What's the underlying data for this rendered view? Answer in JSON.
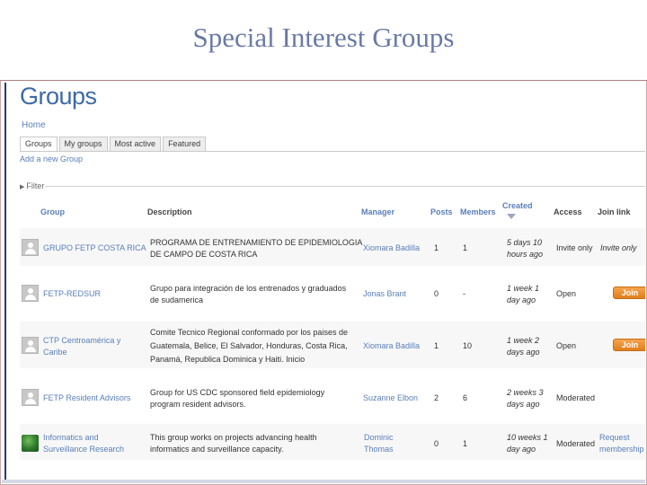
{
  "slide": {
    "title": "Special Interest Groups"
  },
  "page": {
    "heading": "Groups",
    "breadcrumb": "Home",
    "tabs": [
      {
        "label": "Groups",
        "active": true
      },
      {
        "label": "My groups",
        "active": false
      },
      {
        "label": "Most active",
        "active": false
      },
      {
        "label": "Featured",
        "active": false
      }
    ],
    "add_group": "Add a new Group",
    "filter": "Filter"
  },
  "table": {
    "headers": {
      "group": "Group",
      "description": "Description",
      "manager": "Manager",
      "posts": "Posts",
      "members": "Members",
      "created": "Created",
      "access": "Access",
      "join_link": "Join link"
    },
    "rows": [
      {
        "group": "GRUPO FETP COSTA RICA",
        "description_1": "PROGRAMA DE ENTRENAMIENTO DE EPIDEMIOLOGIA",
        "description_2": "DE CAMPO DE COSTA RICA",
        "manager": "Xiomara Badilla",
        "posts": "1",
        "members": "1",
        "created_1": "5 days 10",
        "created_2": "hours ago",
        "access": "Invite only",
        "join": "Invite only",
        "icon": "user-avatar-icon"
      },
      {
        "group": "FETP-REDSUR",
        "description_1": "Grupo para integración de los entrenados y graduados",
        "description_2": "de sudamerica",
        "manager": "Jonas Brant",
        "posts": "0",
        "members": "-",
        "created_1": "1 week 1",
        "created_2": "day ago",
        "access": "Open",
        "join": "Join",
        "icon": "user-avatar-icon"
      },
      {
        "group": "CTP Centroamérica y",
        "group_2": "Caribe",
        "description_1": "Comite Tecnico Regional conformado por los paises de",
        "description_2": "Guatemala, Belice, El Salvador, Honduras, Costa Rica,",
        "description_3": "Panamá, Republica Dominica y Haiti. Inicio",
        "manager": "Xiomara Badilla",
        "posts": "1",
        "members": "10",
        "created_1": "1 week 2",
        "created_2": "days ago",
        "access": "Open",
        "join": "Join",
        "icon": "user-avatar-icon"
      },
      {
        "group": "FETP Resident Advisors",
        "description_1": "Group for US CDC sponsored field epidemiology",
        "description_2": "program resident advisors.",
        "manager": "Suzanne Elbon",
        "posts": "2",
        "members": "6",
        "created_1": "2 weeks 3",
        "created_2": "days ago",
        "access": "Moderated",
        "join": "",
        "icon": "user-avatar-icon"
      },
      {
        "group": "Informatics and",
        "group_2": "Surveillance Research",
        "description_1": "This group works on projects advancing health",
        "description_2": "informatics and surveillance capacity.",
        "manager": "Dominic",
        "manager_2": "Thomas",
        "posts": "0",
        "members": "1",
        "created_1": "10 weeks 1",
        "created_2": "day ago",
        "access": "Moderated",
        "join": "Request",
        "join_2": "membership",
        "icon": "globe-icon"
      }
    ]
  },
  "colors": {
    "title": "#6a7aa6",
    "link": "#5a7fb8",
    "join_button": "#e98a24"
  }
}
